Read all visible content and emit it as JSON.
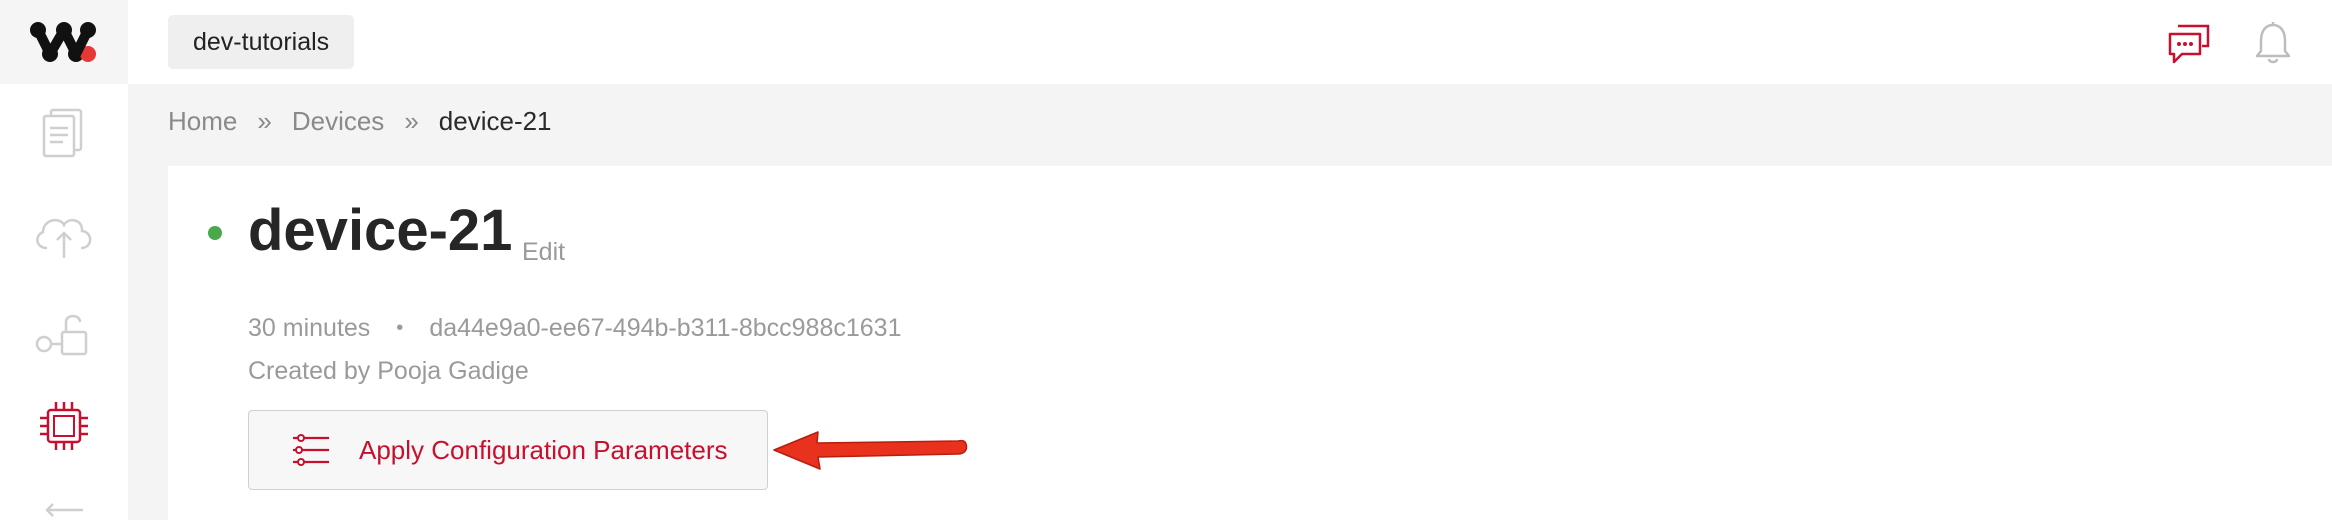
{
  "topbar": {
    "project_name": "dev-tutorials"
  },
  "sidebar": {
    "items": [
      {
        "icon": "clipboard-icon",
        "active": false
      },
      {
        "icon": "cloud-upload-icon",
        "active": false
      },
      {
        "icon": "key-unlock-icon",
        "active": false
      },
      {
        "icon": "chip-icon",
        "active": true
      },
      {
        "icon": "arrow-left-icon",
        "active": false
      }
    ]
  },
  "breadcrumb": {
    "home": "Home",
    "devices": "Devices",
    "current": "device-21",
    "separator": "»"
  },
  "device": {
    "name": "device-21",
    "edit_label": "Edit",
    "age": "30 minutes",
    "meta_separator": "•",
    "uuid": "da44e9a0-ee67-494b-b311-8bcc988c1631",
    "created_by": "Created by Pooja Gadige",
    "status_color": "#4aa84a"
  },
  "actions": {
    "apply_config_label": "Apply Configuration Parameters"
  },
  "colors": {
    "accent": "#c8102e",
    "annotation_arrow": "#e8321e"
  }
}
